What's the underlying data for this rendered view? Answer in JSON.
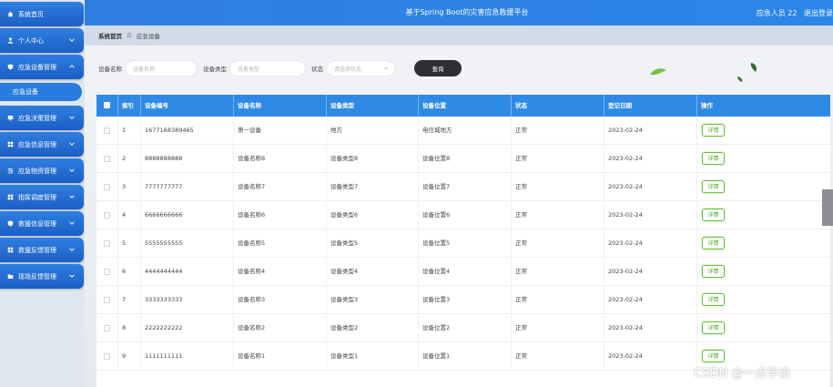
{
  "app": {
    "title": "基于Spring Boot的灾害应急救援平台"
  },
  "header": {
    "user_label": "应急人员 22",
    "logout_label": "退出登录"
  },
  "sidebar": {
    "items": [
      {
        "label": "系统首页",
        "icon": "home-icon"
      },
      {
        "label": "个人中心",
        "icon": "user-icon"
      },
      {
        "label": "应急设备管理",
        "icon": "shield-icon",
        "expanded": true
      },
      {
        "label": "应急决策管理",
        "icon": "monitor-icon"
      },
      {
        "label": "应急信息管理",
        "icon": "grid-icon"
      },
      {
        "label": "应急物资管理",
        "icon": "sliders-icon"
      },
      {
        "label": "指挥调度管理",
        "icon": "grid-icon"
      },
      {
        "label": "救援信息管理",
        "icon": "shield-icon"
      },
      {
        "label": "救援反馈管理",
        "icon": "grid-icon"
      },
      {
        "label": "现场反馈管理",
        "icon": "folder-icon"
      }
    ],
    "sub_item": {
      "label": "应急设备"
    }
  },
  "breadcrumb": {
    "home": "系统首页",
    "current": "应急设备"
  },
  "search": {
    "name_label": "设备名称",
    "name_placeholder": "设备名称",
    "type_label": "设备类型",
    "type_placeholder": "设备类型",
    "status_label": "状态",
    "status_placeholder": "请选择状态",
    "query_label": "查询"
  },
  "table": {
    "headers": [
      "索引",
      "设备编号",
      "设备名称",
      "设备类型",
      "设备位置",
      "状态",
      "登记日期",
      "操作"
    ],
    "detail_label": "详情",
    "rows": [
      {
        "index": "1",
        "code": "1677168389465",
        "name": "第一设备",
        "type": "地方",
        "location": "电信城地方",
        "status": "正常",
        "date": "2023-02-24"
      },
      {
        "index": "2",
        "code": "8888888888",
        "name": "设备名称8",
        "type": "设备类型8",
        "location": "设备位置8",
        "status": "正常",
        "date": "2023-02-24"
      },
      {
        "index": "3",
        "code": "7777777777",
        "name": "设备名称7",
        "type": "设备类型7",
        "location": "设备位置7",
        "status": "正常",
        "date": "2023-02-24"
      },
      {
        "index": "4",
        "code": "6666666666",
        "name": "设备名称6",
        "type": "设备类型6",
        "location": "设备位置6",
        "status": "正常",
        "date": "2023-02-24"
      },
      {
        "index": "5",
        "code": "5555555555",
        "name": "设备名称5",
        "type": "设备类型5",
        "location": "设备位置5",
        "status": "正常",
        "date": "2023-02-24"
      },
      {
        "index": "6",
        "code": "4444444444",
        "name": "设备名称4",
        "type": "设备类型4",
        "location": "设备位置4",
        "status": "正常",
        "date": "2023-02-24"
      },
      {
        "index": "7",
        "code": "3333333333",
        "name": "设备名称3",
        "type": "设备类型3",
        "location": "设备位置3",
        "status": "正常",
        "date": "2023-02-24"
      },
      {
        "index": "8",
        "code": "2222222222",
        "name": "设备名称2",
        "type": "设备类型2",
        "location": "设备位置2",
        "status": "正常",
        "date": "2023-02-24"
      },
      {
        "index": "9",
        "code": "1111111111",
        "name": "设备名称1",
        "type": "设备类型1",
        "location": "设备位置1",
        "status": "正常",
        "date": "2023-02-24"
      }
    ]
  },
  "watermark": "CSDN @一点毕设",
  "colors": {
    "primary": "#2f8ae6",
    "detail_green": "#6bbf3a",
    "query_button": "#2d2f33"
  }
}
